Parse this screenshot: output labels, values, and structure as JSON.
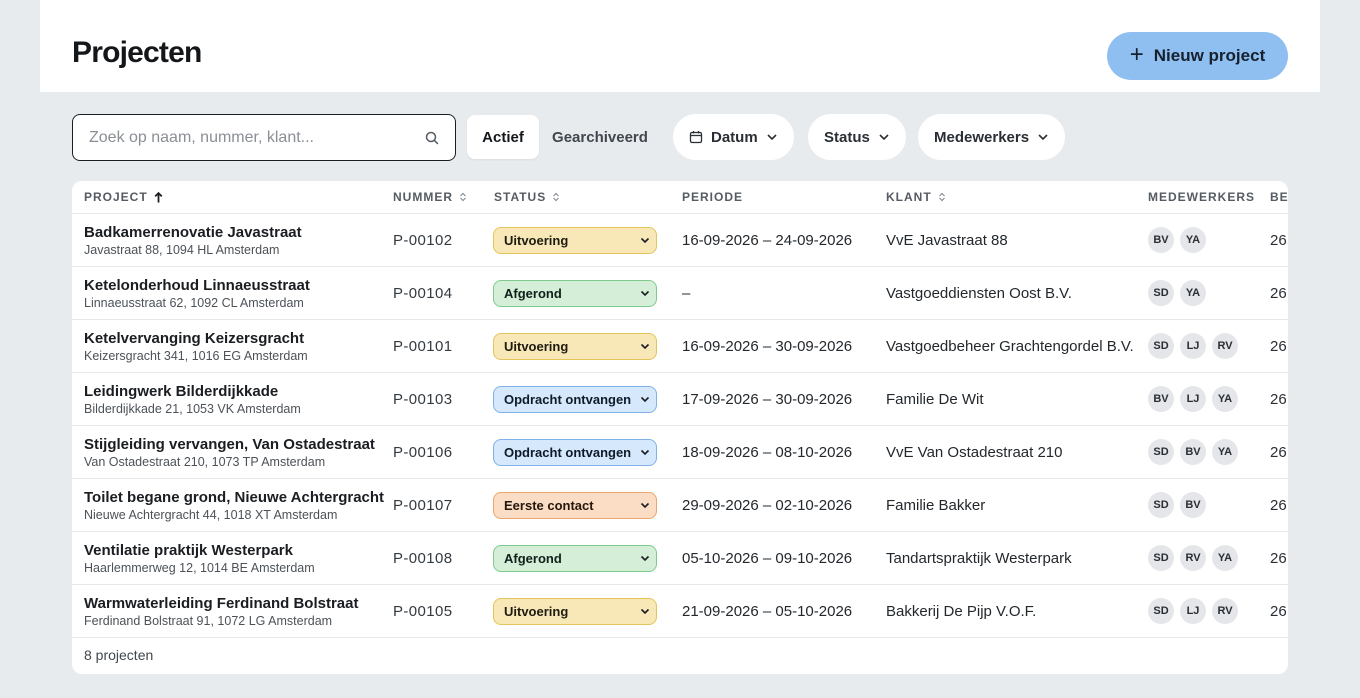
{
  "header": {
    "title": "Projecten",
    "new_button_label": "Nieuw project",
    "new_button_icon": "plus-icon"
  },
  "toolbar": {
    "search_placeholder": "Zoek op naam, nummer, klant...",
    "search_value": "",
    "tabs": [
      {
        "label": "Actief",
        "active": true
      },
      {
        "label": "Gearchiveerd",
        "active": false
      }
    ],
    "filters": [
      {
        "label": "Datum",
        "icon": "calendar-icon"
      },
      {
        "label": "Status"
      },
      {
        "label": "Medewerkers"
      }
    ]
  },
  "table": {
    "columns": {
      "project": "PROJECT",
      "nummer": "NUMMER",
      "status": "STATUS",
      "periode": "PERIODE",
      "klant": "KLANT",
      "medewerkers": "MEDEWERKERS",
      "truncated": "BE"
    },
    "sort": {
      "column": "project",
      "direction": "asc"
    },
    "rows": [
      {
        "name": "Badkamerrenovatie Javastraat",
        "address": "Javastraat 88, 1094 HL Amsterdam",
        "number": "P-00102",
        "status": "Uitvoering",
        "period": "16-09-2026 – 24-09-2026",
        "client": "VvE Javastraat 88",
        "staff": [
          "BV",
          "YA"
        ],
        "truncated": "26"
      },
      {
        "name": "Ketelonderhoud Linnaeusstraat",
        "address": "Linnaeusstraat 62, 1092 CL Amsterdam",
        "number": "P-00104",
        "status": "Afgerond",
        "period": "–",
        "client": "Vastgoeddiensten Oost B.V.",
        "staff": [
          "SD",
          "YA"
        ],
        "truncated": "26"
      },
      {
        "name": "Ketelvervanging Keizersgracht",
        "address": "Keizersgracht 341, 1016 EG Amsterdam",
        "number": "P-00101",
        "status": "Uitvoering",
        "period": "16-09-2026 – 30-09-2026",
        "client": "Vastgoedbeheer Grachtengordel B.V.",
        "staff": [
          "SD",
          "LJ",
          "RV"
        ],
        "truncated": "26"
      },
      {
        "name": "Leidingwerk Bilderdijkkade",
        "address": "Bilderdijkkade 21, 1053 VK Amsterdam",
        "number": "P-00103",
        "status": "Opdracht ontvangen",
        "period": "17-09-2026 – 30-09-2026",
        "client": "Familie De Wit",
        "staff": [
          "BV",
          "LJ",
          "YA"
        ],
        "truncated": "26"
      },
      {
        "name": "Stijgleiding vervangen, Van Ostadestraat",
        "address": "Van Ostadestraat 210, 1073 TP Amsterdam",
        "number": "P-00106",
        "status": "Opdracht ontvangen",
        "period": "18-09-2026 – 08-10-2026",
        "client": "VvE Van Ostadestraat 210",
        "staff": [
          "SD",
          "BV",
          "YA"
        ],
        "truncated": "26"
      },
      {
        "name": "Toilet begane grond, Nieuwe Achtergracht",
        "address": "Nieuwe Achtergracht 44, 1018 XT Amsterdam",
        "number": "P-00107",
        "status": "Eerste contact",
        "period": "29-09-2026 – 02-10-2026",
        "client": "Familie Bakker",
        "staff": [
          "SD",
          "BV"
        ],
        "truncated": "26"
      },
      {
        "name": "Ventilatie praktijk Westerpark",
        "address": "Haarlemmerweg 12, 1014 BE Amsterdam",
        "number": "P-00108",
        "status": "Afgerond",
        "period": "05-10-2026 – 09-10-2026",
        "client": "Tandartspraktijk Westerpark",
        "staff": [
          "SD",
          "RV",
          "YA"
        ],
        "truncated": "26"
      },
      {
        "name": "Warmwaterleiding Ferdinand Bolstraat",
        "address": "Ferdinand Bolstraat 91, 1072 LG Amsterdam",
        "number": "P-00105",
        "status": "Uitvoering",
        "period": "21-09-2026 – 05-10-2026",
        "client": "Bakkerij De Pijp V.O.F.",
        "staff": [
          "SD",
          "LJ",
          "RV"
        ],
        "truncated": "26"
      }
    ],
    "footer": "8 projecten"
  },
  "status_colors": {
    "Uitvoering": {
      "bg": "#f8e8b8",
      "border": "#e3c55c",
      "text": "#1e1b10"
    },
    "Afgerond": {
      "bg": "#d4eed8",
      "border": "#7fcb8d",
      "text": "#11201a"
    },
    "Opdracht ontvangen": {
      "bg": "#d6e8fb",
      "border": "#7fb2e8",
      "text": "#0f1b2a"
    },
    "Eerste contact": {
      "bg": "#fbdcc4",
      "border": "#eba66f",
      "text": "#25170c"
    }
  },
  "colors": {
    "page_bg": "#e8ebee",
    "primary_button": "#8fbff0",
    "avatar_bg": "#e4e6e9"
  }
}
